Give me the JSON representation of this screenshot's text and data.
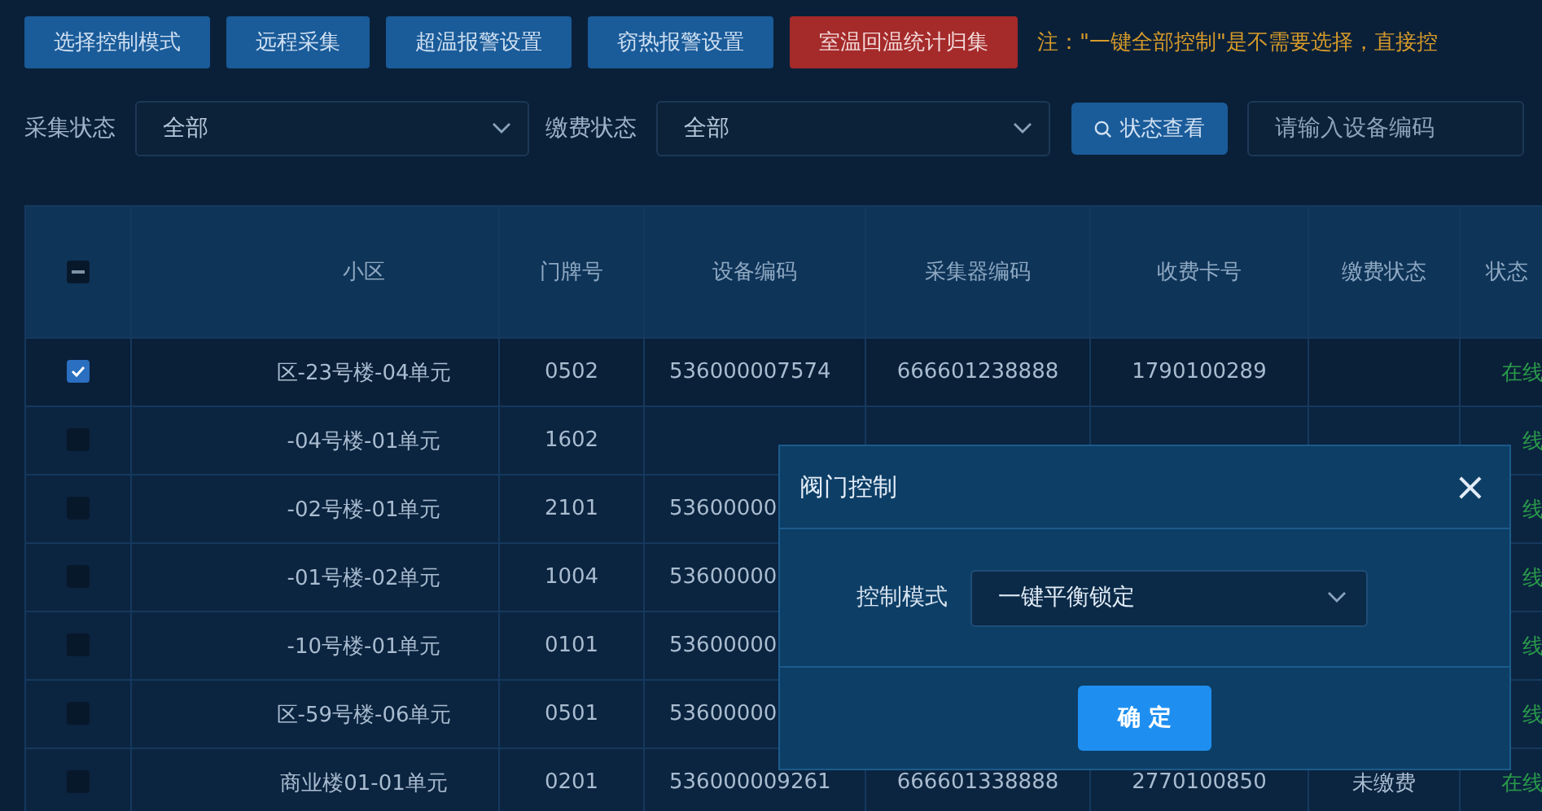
{
  "toolbar": {
    "buttons": [
      {
        "label": "选择控制模式",
        "kind": "primary"
      },
      {
        "label": "远程采集",
        "kind": "primary"
      },
      {
        "label": "超温报警设置",
        "kind": "primary"
      },
      {
        "label": "窃热报警设置",
        "kind": "primary"
      },
      {
        "label": "室温回温统计归集",
        "kind": "danger"
      }
    ],
    "note": "注：\"一键全部控制\"是不需要选择，直接控"
  },
  "filters": {
    "fields": [
      {
        "label": "采集状态",
        "value": "全部"
      },
      {
        "label": "缴费状态",
        "value": "全部"
      }
    ],
    "search_button": "状态查看",
    "code_input": {
      "placeholder": "请输入设备编码"
    }
  },
  "table": {
    "header_checkbox": {
      "indeterminate": true
    },
    "columns": [
      "小区",
      "门牌号",
      "设备编码",
      "采集器编码",
      "收费卡号",
      "缴费状态",
      "状态"
    ],
    "rows": [
      {
        "checked": true,
        "cells": [
          "区-23号楼-04单元",
          "0502",
          "536000007574",
          "666601238888",
          "1790100289",
          "",
          "在线"
        ]
      },
      {
        "checked": false,
        "cells": [
          "-04号楼-01单元",
          "1602",
          "",
          "",
          "",
          "",
          "线"
        ]
      },
      {
        "checked": false,
        "cells": [
          "-02号楼-01单元",
          "2101",
          "53600000",
          "",
          "",
          "",
          "线"
        ]
      },
      {
        "checked": false,
        "cells": [
          "-01号楼-02单元",
          "1004",
          "53600000",
          "",
          "",
          "",
          "线"
        ]
      },
      {
        "checked": false,
        "cells": [
          "-10号楼-01单元",
          "0101",
          "53600000",
          "",
          "",
          "",
          "线"
        ]
      },
      {
        "checked": false,
        "cells": [
          "区-59号楼-06单元",
          "0501",
          "53600000",
          "",
          "",
          "",
          "线"
        ]
      },
      {
        "checked": false,
        "cells": [
          "商业楼01-01单元",
          "0201",
          "536000009261",
          "666601338888",
          "2770100850",
          "未缴费",
          "在线"
        ]
      }
    ]
  },
  "dialog": {
    "title": "阀门控制",
    "close": "×",
    "field_label": "控制模式",
    "field_value": "一键平衡锁定",
    "confirm": "确 定"
  }
}
